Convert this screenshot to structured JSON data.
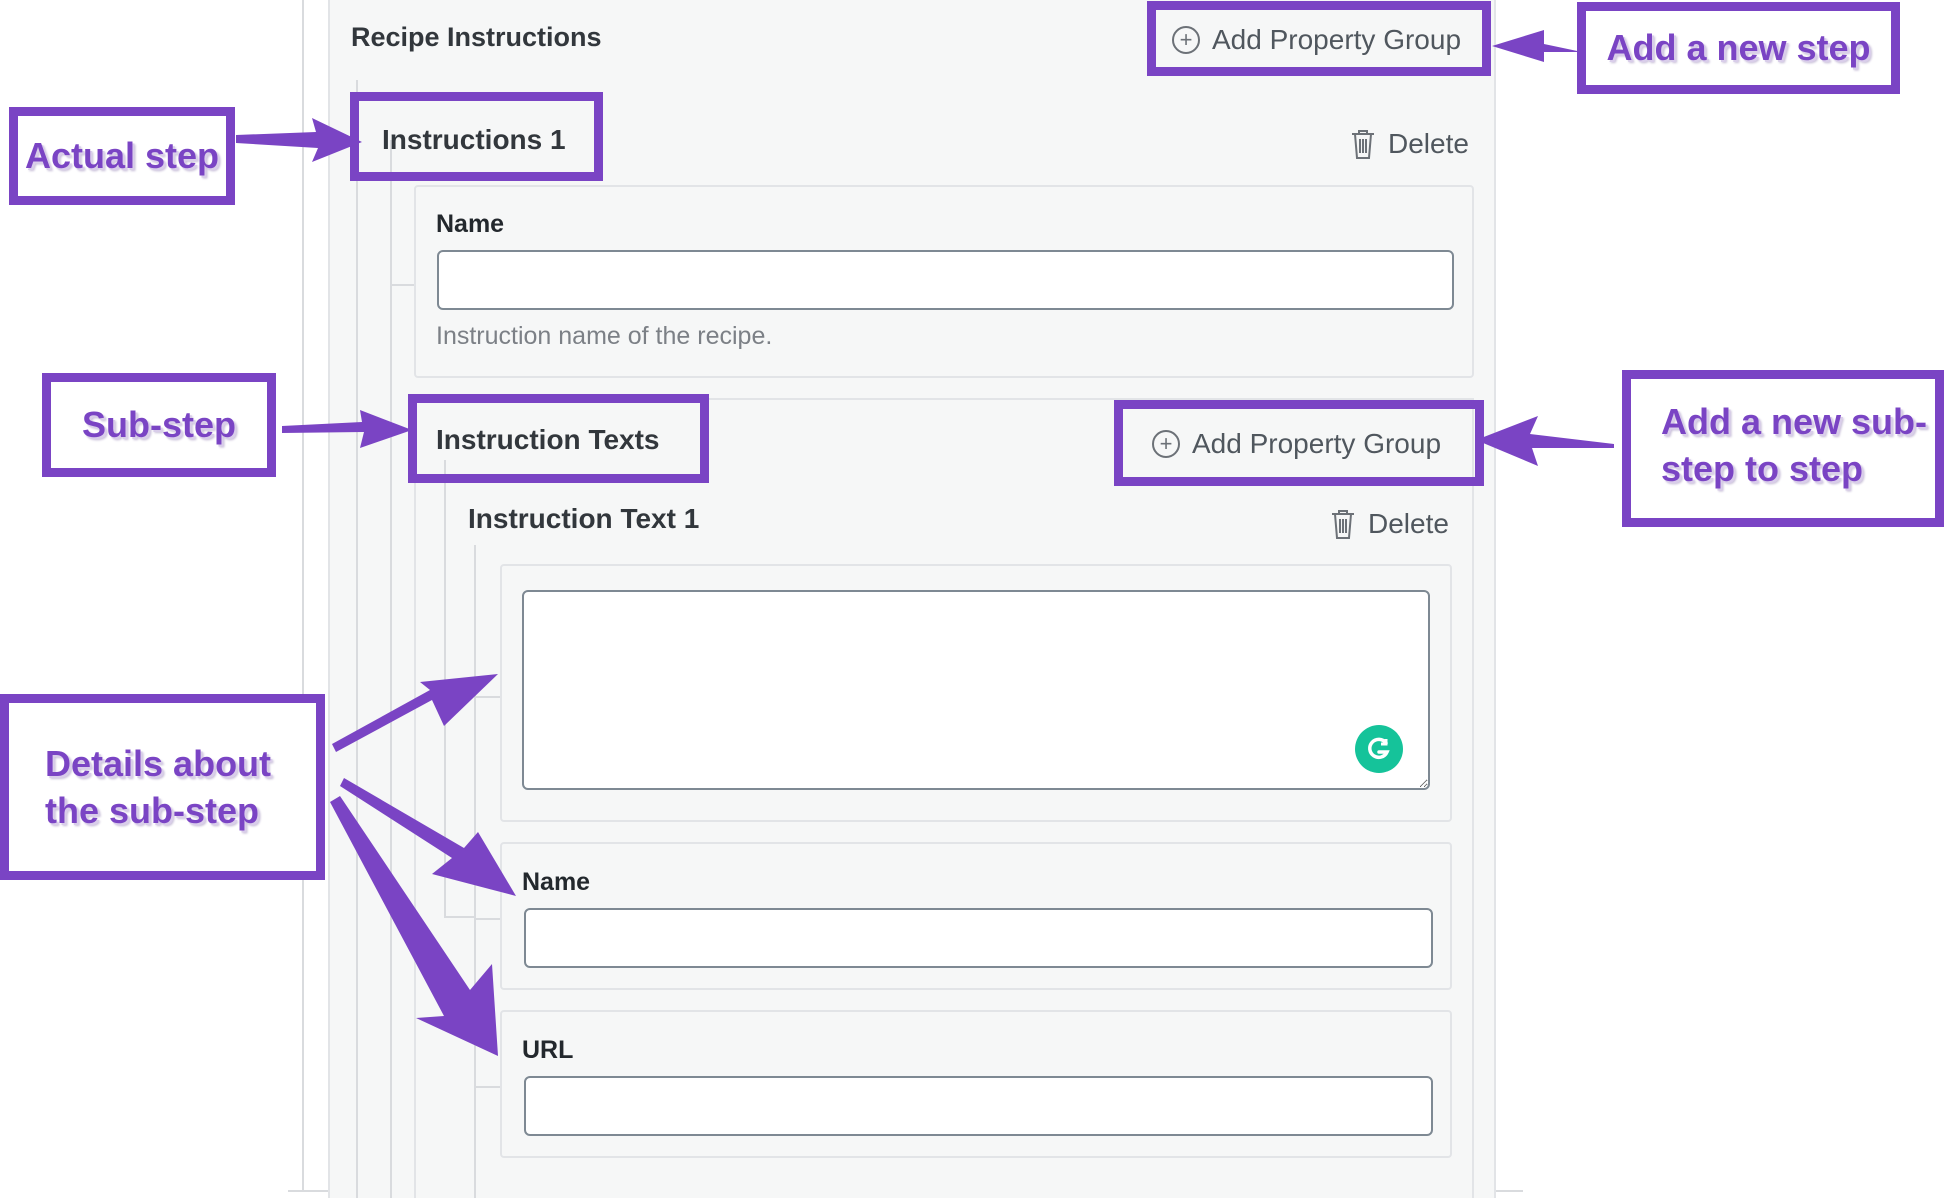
{
  "section": {
    "title": "Recipe Instructions",
    "add_group_label": "Add Property Group"
  },
  "step": {
    "title": "Instructions 1",
    "delete_label": "Delete",
    "name_label": "Name",
    "name_value": "",
    "name_help": "Instruction name of the recipe."
  },
  "substep_group": {
    "title": "Instruction Texts",
    "add_group_label": "Add Property Group"
  },
  "substep": {
    "title": "Instruction Text 1",
    "delete_label": "Delete",
    "text_value": "",
    "name_label": "Name",
    "name_value": "",
    "url_label": "URL",
    "url_value": ""
  },
  "annotations": {
    "add_step": "Add a new step",
    "actual_step": "Actual step",
    "sub_step": "Sub-step",
    "add_substep_line1": "Add a new sub-",
    "add_substep_line2": "step to step",
    "details_line1": "Details about",
    "details_line2": "the sub-step"
  },
  "colors": {
    "annotation": "#7a44c4",
    "grammarly": "#15c39a"
  },
  "icons": {
    "add": "circle-plus-icon",
    "delete": "trash-icon",
    "grammarly": "grammarly-icon"
  }
}
